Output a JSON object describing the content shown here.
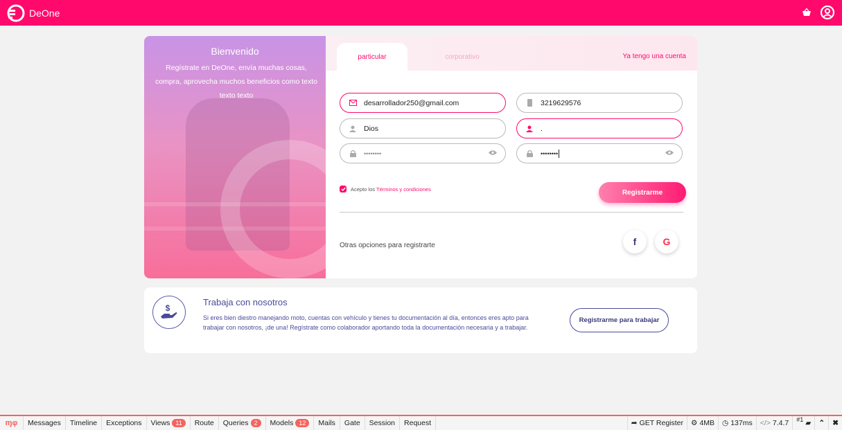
{
  "app": {
    "name": "DeOne"
  },
  "welcome": {
    "title": "Bienvenido",
    "text": "Regístrate en DeOne, envía muchas cosas, compra, aprovecha muchos beneficios como texto texto texto"
  },
  "tabs": {
    "particular": "particular",
    "corporativo": "corporativo",
    "have_account": "Ya tengo una cuenta"
  },
  "form": {
    "email": "desarrollador250@gmail.com",
    "phone": "3219629576",
    "first_name": "Dios",
    "last_name": ".",
    "password": "••••••••",
    "password_confirm": "••••••••"
  },
  "terms": {
    "prefix": "Acepto los",
    "link": "Términos y condiciones"
  },
  "register_button": "Registrarme",
  "other_options": "Otras opciones para registrarte",
  "social": {
    "facebook": "f",
    "google": "G"
  },
  "work": {
    "title": "Trabaja con nosotros",
    "text": "Si eres bien diestro manejando moto, cuentas con vehículo y tienes tu documentación al día, entonces eres apto para trabajar con nosotros, ¡de una! Regístrate como colaborador aportando toda la documentación necesaria y a trabajar.",
    "button": "Registrarme para trabajar"
  },
  "debugbar": {
    "tabs": [
      {
        "label": "Messages",
        "badge": null
      },
      {
        "label": "Timeline",
        "badge": null
      },
      {
        "label": "Exceptions",
        "badge": null
      },
      {
        "label": "Views",
        "badge": "11"
      },
      {
        "label": "Route",
        "badge": null
      },
      {
        "label": "Queries",
        "badge": "2"
      },
      {
        "label": "Models",
        "badge": "12"
      },
      {
        "label": "Mails",
        "badge": null
      },
      {
        "label": "Gate",
        "badge": null
      },
      {
        "label": "Session",
        "badge": null
      },
      {
        "label": "Request",
        "badge": null
      }
    ],
    "route": "GET Register",
    "memory": "4MB",
    "time": "137ms",
    "php_version": "7.4.7",
    "request_count": "#1"
  },
  "colors": {
    "brand": "#ff0a6c",
    "accent_text": "#4a4a9a",
    "debug_accent": "#f4645f"
  }
}
